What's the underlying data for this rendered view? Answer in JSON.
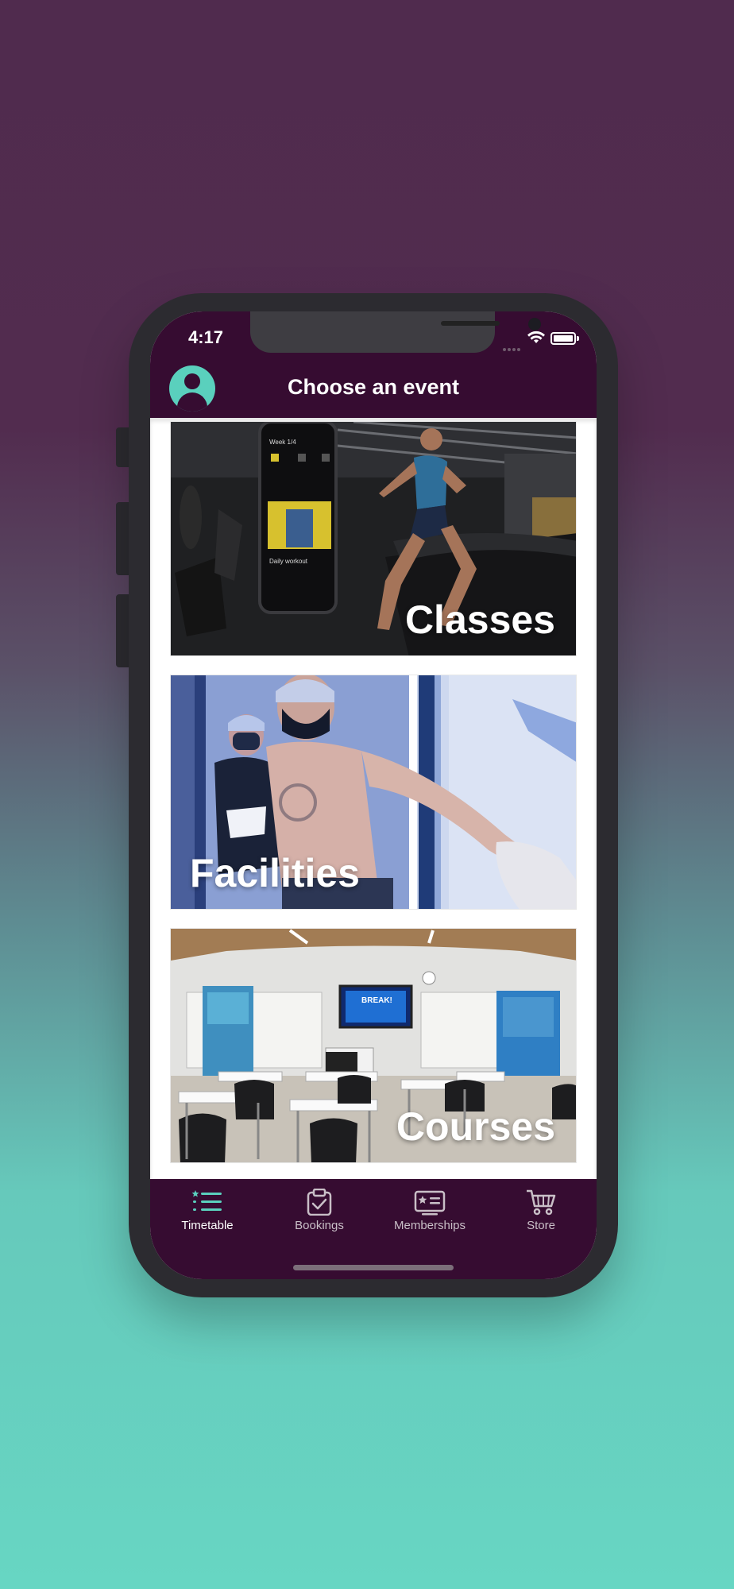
{
  "status_bar": {
    "time": "4:17"
  },
  "header": {
    "title": "Choose an event",
    "avatar_icon": "user-avatar-icon"
  },
  "events": [
    {
      "label": "Classes"
    },
    {
      "label": "Facilities"
    },
    {
      "label": "Courses"
    }
  ],
  "tabs": [
    {
      "label": "Timetable",
      "icon": "timetable-icon",
      "active": true
    },
    {
      "label": "Bookings",
      "icon": "clipboard-check-icon",
      "active": false
    },
    {
      "label": "Memberships",
      "icon": "membership-card-icon",
      "active": false
    },
    {
      "label": "Store",
      "icon": "cart-icon",
      "active": false
    }
  ],
  "colors": {
    "brand_dark": "#360c31",
    "accent_teal": "#5ad0bd",
    "background_top": "#502b4e",
    "background_bottom": "#67d6c3"
  }
}
